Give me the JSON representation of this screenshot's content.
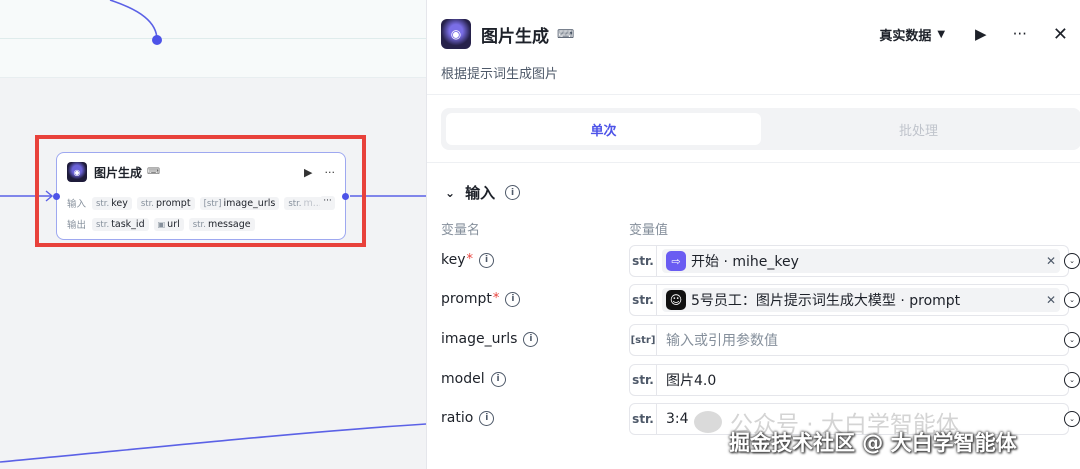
{
  "canvas_node": {
    "title": "图片生成",
    "input_label": "输入",
    "output_label": "输出",
    "inputs": [
      {
        "type": "str.",
        "name": "key"
      },
      {
        "type": "str.",
        "name": "prompt"
      },
      {
        "type": "[str]",
        "name": "image_urls"
      },
      {
        "type": "str.",
        "name": "m..."
      }
    ],
    "outputs": [
      {
        "type": "str.",
        "name": "task_id"
      },
      {
        "type": "img",
        "name": "url"
      },
      {
        "type": "str.",
        "name": "message"
      }
    ],
    "more": "···"
  },
  "panel": {
    "title": "图片生成",
    "data_mode": "真实数据",
    "description": "根据提示词生成图片",
    "tabs": [
      "单次",
      "批处理"
    ],
    "section_title": "输入",
    "col_name": "变量名",
    "col_value": "变量值",
    "params": [
      {
        "name": "key",
        "required": true,
        "type": "str.",
        "kind": "ref",
        "icon": "start-icon",
        "ref_text": "开始 · mihe_key"
      },
      {
        "name": "prompt",
        "required": true,
        "type": "str.",
        "kind": "ref",
        "icon": "bot-icon",
        "ref_text": "5号员工：图片提示词生成大模型 · prompt"
      },
      {
        "name": "image_urls",
        "required": false,
        "type": "[str]",
        "kind": "input",
        "placeholder": "输入或引用参数值"
      },
      {
        "name": "model",
        "required": false,
        "type": "str.",
        "kind": "value",
        "value": "图片4.0"
      },
      {
        "name": "ratio",
        "required": false,
        "type": "str.",
        "kind": "value",
        "value": "3:4"
      }
    ]
  },
  "watermark": {
    "line1": "公众号 · 大白学智能体",
    "line2": "掘金技术社区 @ 大白学智能体"
  },
  "colors": {
    "accent": "#4d53e8",
    "highlight": "#e8413b",
    "required": "#e8413b"
  }
}
